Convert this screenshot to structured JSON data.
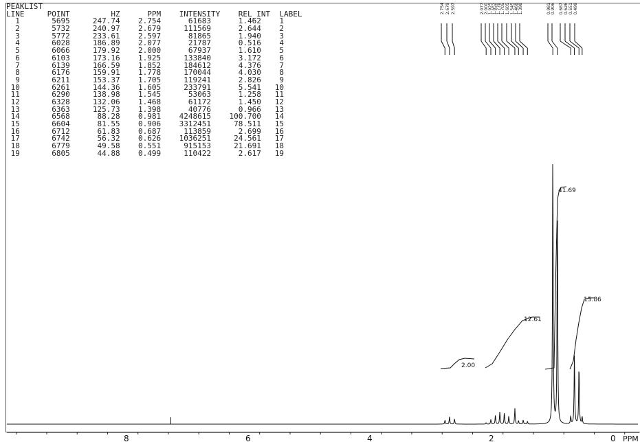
{
  "peaklist": {
    "title": "PEAKLIST",
    "headers": [
      "LINE",
      "POINT",
      "HZ",
      "PPM",
      "INTENSITY",
      "REL_INT",
      "LABEL"
    ],
    "rows": [
      [
        "1",
        "5695",
        "247.74",
        "2.754",
        "61683",
        "1.462",
        "1"
      ],
      [
        "2",
        "5732",
        "240.97",
        "2.679",
        "111569",
        "2.644",
        "2"
      ],
      [
        "3",
        "5772",
        "233.61",
        "2.597",
        "81865",
        "1.940",
        "3"
      ],
      [
        "4",
        "6028",
        "186.89",
        "2.077",
        "21787",
        "0.516",
        "4"
      ],
      [
        "5",
        "6066",
        "179.92",
        "2.000",
        "67937",
        "1.610",
        "5"
      ],
      [
        "6",
        "6103",
        "173.16",
        "1.925",
        "133840",
        "3.172",
        "6"
      ],
      [
        "7",
        "6139",
        "166.59",
        "1.852",
        "184612",
        "4.376",
        "7"
      ],
      [
        "8",
        "6176",
        "159.91",
        "1.778",
        "170044",
        "4.030",
        "8"
      ],
      [
        "9",
        "6211",
        "153.37",
        "1.705",
        "119241",
        "2.826",
        "9"
      ],
      [
        "10",
        "6261",
        "144.36",
        "1.605",
        "233791",
        "5.541",
        "10"
      ],
      [
        "11",
        "6290",
        "138.98",
        "1.545",
        "53063",
        "1.258",
        "11"
      ],
      [
        "12",
        "6328",
        "132.06",
        "1.468",
        "61172",
        "1.450",
        "12"
      ],
      [
        "13",
        "6363",
        "125.73",
        "1.398",
        "40776",
        "0.966",
        "13"
      ],
      [
        "14",
        "6568",
        "88.28",
        "0.981",
        "4248615",
        "100.700",
        "14"
      ],
      [
        "15",
        "6604",
        "81.55",
        "0.906",
        "3312451",
        "78.511",
        "15"
      ],
      [
        "16",
        "6712",
        "61.83",
        "0.687",
        "113859",
        "2.699",
        "16"
      ],
      [
        "17",
        "6742",
        "56.32",
        "0.626",
        "1036251",
        "24.561",
        "17"
      ],
      [
        "18",
        "6779",
        "49.58",
        "0.551",
        "915153",
        "21.691",
        "18"
      ],
      [
        "19",
        "6805",
        "44.88",
        "0.499",
        "110422",
        "2.617",
        "19"
      ]
    ]
  },
  "chart_data": {
    "type": "line",
    "xlabel": "PPM",
    "x_ticks": [
      "8",
      "6",
      "4",
      "2",
      "0"
    ],
    "x_reversed": true,
    "peaks_ppm": [
      2.754,
      2.679,
      2.597,
      2.077,
      2.0,
      1.925,
      1.852,
      1.778,
      1.705,
      1.605,
      1.545,
      1.468,
      1.398,
      0.981,
      0.906,
      0.687,
      0.626,
      0.551,
      0.499
    ],
    "peaks_rel_int": [
      1.462,
      2.644,
      1.94,
      0.516,
      1.61,
      3.172,
      4.376,
      4.03,
      2.826,
      5.541,
      1.258,
      1.45,
      0.966,
      100.7,
      78.511,
      2.699,
      24.561,
      21.691,
      2.617
    ],
    "peak_labels": [
      "2.754",
      "2.679",
      "2.597",
      "2.077",
      "2.000",
      "1.925",
      "1.852",
      "1.778",
      "1.705",
      "1.605",
      "1.545",
      "1.468",
      "1.398",
      "0.981",
      "0.906",
      "0.687",
      "0.626",
      "0.551",
      "0.499"
    ],
    "integrals": [
      {
        "value": "2.00"
      },
      {
        "value": "12.61"
      },
      {
        "value": "41.69"
      },
      {
        "value": "15.86"
      }
    ]
  }
}
